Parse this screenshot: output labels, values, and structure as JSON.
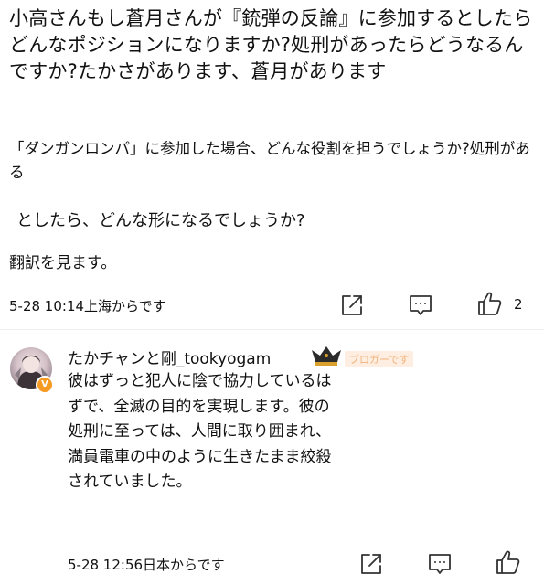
{
  "main_comment": {
    "question_text": "小高さんもし蒼月さんが『銃弾の反論』に参加するとしたらどんなポジションになりますか?処刑があったらどうなるんですか?たかさがあります、蒼月があります",
    "translation_part1": "「ダンガンロンパ」に参加した場合、どんな役割を担うでしょうか?処刑がある",
    "translation_part2": "としたら、どんな形になるでしょうか?",
    "translate_link": "翻訳を見ます。",
    "timestamp_location": "5-28 10:14上海からです",
    "like_count": "2"
  },
  "reply": {
    "username": "たかチャンと剛_tookyogam",
    "user_tag": "ブロガーです",
    "avatar_badge": "V",
    "body": "彼はずっと犯人に陰で協力しているはずで、全滅の目的を実現します。彼の処刑に至っては、人間に取り囲まれ、満員電車の中のように生きたまま絞殺されていました。",
    "timestamp_location": "5-28 12:56日本からです"
  },
  "icons": {
    "share": "share-icon",
    "comment": "comment-icon",
    "like": "thumbs-up-icon"
  },
  "colors": {
    "text": "#111111",
    "badge": "#f59a23",
    "blogger_tag": "#f3b27a"
  }
}
